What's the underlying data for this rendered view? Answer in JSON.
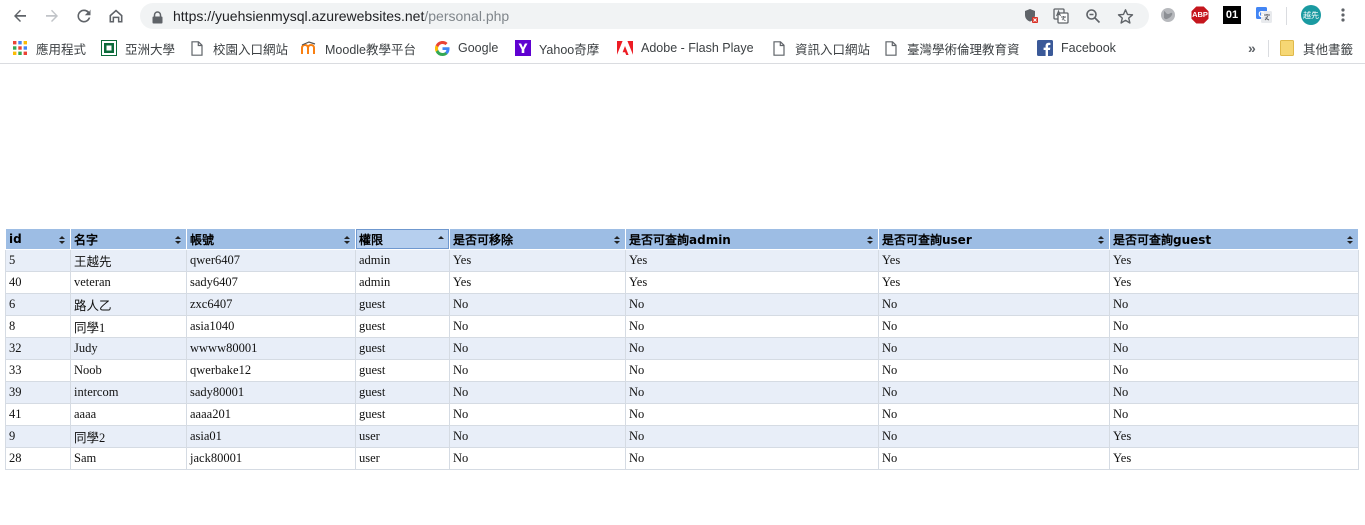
{
  "browser": {
    "url_host": "https://yuehsienmysql.azurewebsites.net",
    "url_path": "/personal.php",
    "profile_avatar": "越先",
    "extension_abp": "ABP",
    "extension_01": "01",
    "nav_icons": [
      "back-icon",
      "forward-icon",
      "reload-icon",
      "home-icon"
    ],
    "omnibox_icons": [
      "shield-blocked-icon",
      "translate-icon",
      "zoom-icon",
      "star-icon"
    ]
  },
  "bookmarks": {
    "items": [
      {
        "label": "應用程式",
        "icon": "apps-icon"
      },
      {
        "label": "亞洲大學",
        "icon": "asia-university-icon"
      },
      {
        "label": "校園入口網站",
        "icon": "page-icon"
      },
      {
        "label": "Moodle教學平台",
        "icon": "moodle-icon"
      },
      {
        "label": "Google",
        "icon": "google-icon"
      },
      {
        "label": "Yahoo奇摩",
        "icon": "yahoo-icon"
      },
      {
        "label": "Adobe - Flash Playe",
        "icon": "adobe-icon"
      },
      {
        "label": "資訊入口網站",
        "icon": "page-icon"
      },
      {
        "label": "臺灣學術倫理教育資",
        "icon": "page-icon"
      },
      {
        "label": "Facebook",
        "icon": "facebook-icon"
      }
    ],
    "overflow": "»",
    "other_label": "其他書籤"
  },
  "table": {
    "columns": [
      "id",
      "名字",
      "帳號",
      "權限",
      "是否可移除",
      "是否可查詢admin",
      "是否可查詢user",
      "是否可查詢guest"
    ],
    "sorted_column": "權限",
    "sorted_direction": "ascending",
    "colors": {
      "header": "#9dbde4",
      "header_sorted": "#b6cfee",
      "row_odd": "#e8eef8",
      "row_even": "#ffffff"
    },
    "rows": [
      [
        "5",
        "王越先",
        "qwer6407",
        "admin",
        "Yes",
        "Yes",
        "Yes",
        "Yes"
      ],
      [
        "40",
        "veteran",
        "sady6407",
        "admin",
        "Yes",
        "Yes",
        "Yes",
        "Yes"
      ],
      [
        "6",
        "路人乙",
        "zxc6407",
        "guest",
        "No",
        "No",
        "No",
        "No"
      ],
      [
        "8",
        "同學1",
        "asia1040",
        "guest",
        "No",
        "No",
        "No",
        "No"
      ],
      [
        "32",
        "Judy",
        "wwww80001",
        "guest",
        "No",
        "No",
        "No",
        "No"
      ],
      [
        "33",
        "Noob",
        "qwerbake12",
        "guest",
        "No",
        "No",
        "No",
        "No"
      ],
      [
        "39",
        "intercom",
        "sady80001",
        "guest",
        "No",
        "No",
        "No",
        "No"
      ],
      [
        "41",
        "aaaa",
        "aaaa201",
        "guest",
        "No",
        "No",
        "No",
        "No"
      ],
      [
        "9",
        "同學2",
        "asia01",
        "user",
        "No",
        "No",
        "No",
        "Yes"
      ],
      [
        "28",
        "Sam",
        "jack80001",
        "user",
        "No",
        "No",
        "No",
        "Yes"
      ]
    ]
  }
}
